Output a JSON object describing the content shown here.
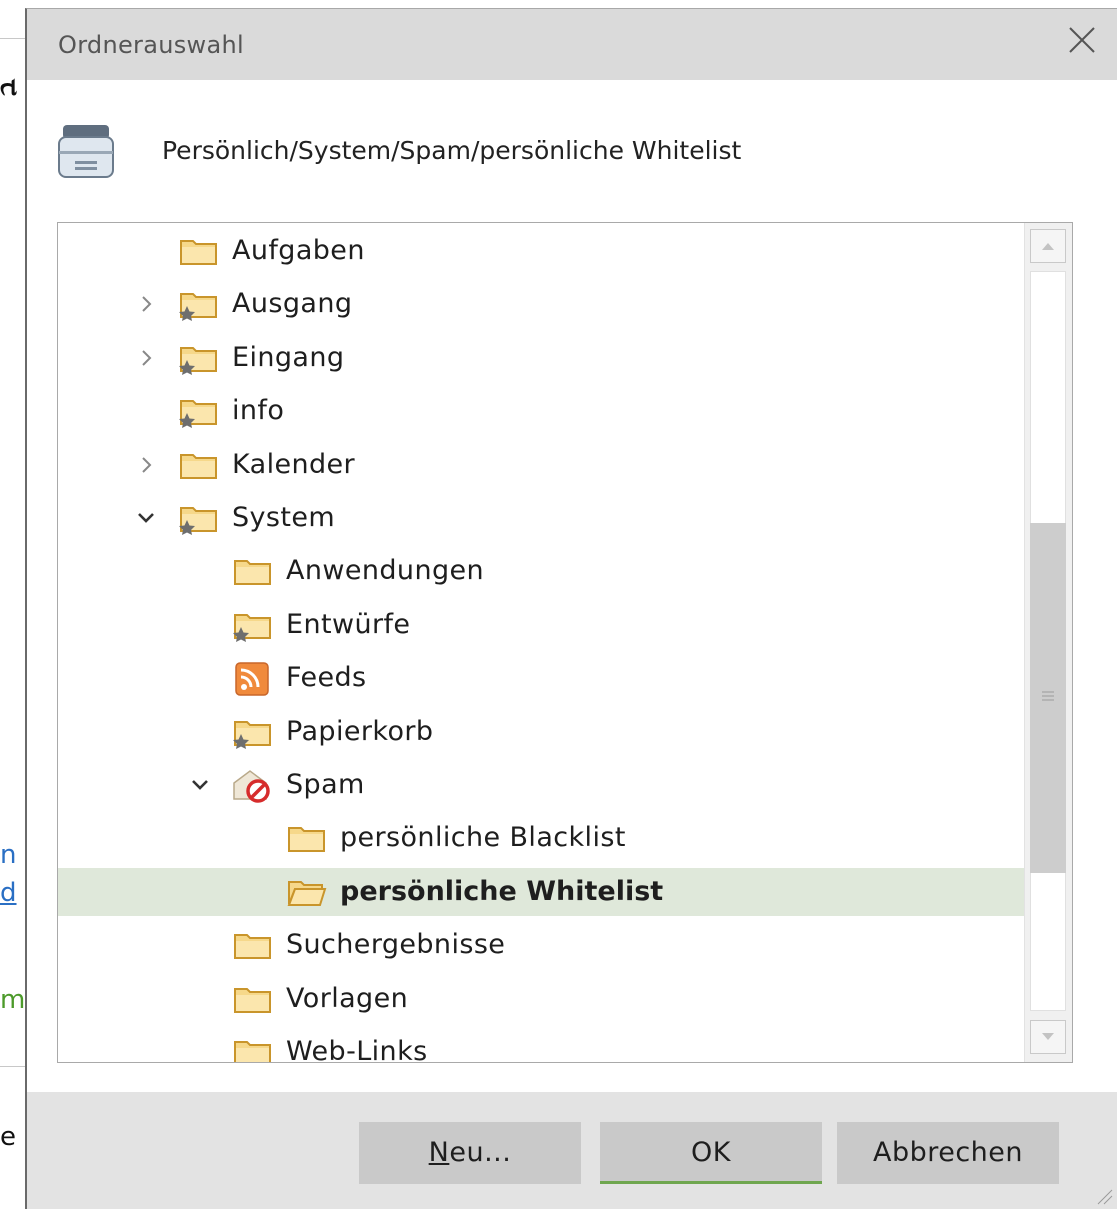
{
  "dialog": {
    "title": "Ordnerauswahl",
    "close_glyph": "✕",
    "path": "Persönlich/System/Spam/persönliche Whitelist"
  },
  "tree": {
    "items": [
      {
        "label": "Aufgaben",
        "icon": "folder-icon",
        "expander": "none",
        "level": 0
      },
      {
        "label": "Ausgang",
        "icon": "special-folder-icon",
        "expander": "collapsed",
        "level": 0
      },
      {
        "label": "Eingang",
        "icon": "special-folder-icon",
        "expander": "collapsed",
        "level": 0
      },
      {
        "label": "info",
        "icon": "special-folder-icon",
        "expander": "none",
        "level": 0
      },
      {
        "label": "Kalender",
        "icon": "folder-icon",
        "expander": "collapsed",
        "level": 0
      },
      {
        "label": "System",
        "icon": "special-folder-icon",
        "expander": "expanded",
        "level": 0
      },
      {
        "label": "Anwendungen",
        "icon": "folder-icon",
        "expander": "none",
        "level": 1
      },
      {
        "label": "Entwürfe",
        "icon": "special-folder-icon",
        "expander": "none",
        "level": 1
      },
      {
        "label": "Feeds",
        "icon": "rss-icon",
        "expander": "none",
        "level": 1
      },
      {
        "label": "Papierkorb",
        "icon": "special-folder-icon",
        "expander": "none",
        "level": 1
      },
      {
        "label": "Spam",
        "icon": "spam-icon",
        "expander": "expanded",
        "level": 1
      },
      {
        "label": "persönliche Blacklist",
        "icon": "folder-icon",
        "expander": "none",
        "level": 2
      },
      {
        "label": "persönliche Whitelist",
        "icon": "open-folder-icon",
        "expander": "none",
        "level": 2,
        "selected": true
      },
      {
        "label": "Suchergebnisse",
        "icon": "folder-icon",
        "expander": "none",
        "level": 1
      },
      {
        "label": "Vorlagen",
        "icon": "folder-icon",
        "expander": "none",
        "level": 1
      },
      {
        "label": "Web-Links",
        "icon": "folder-icon",
        "expander": "none",
        "level": 1
      }
    ]
  },
  "buttons": {
    "new_mnemonic": "N",
    "new_rest": "eu...",
    "ok": "OK",
    "cancel": "Abbrechen"
  },
  "colors": {
    "selection": "#dfe8da",
    "ok_accent": "#6fa64f",
    "folder_fill": "#f6d88a",
    "folder_stroke": "#c9952b"
  }
}
